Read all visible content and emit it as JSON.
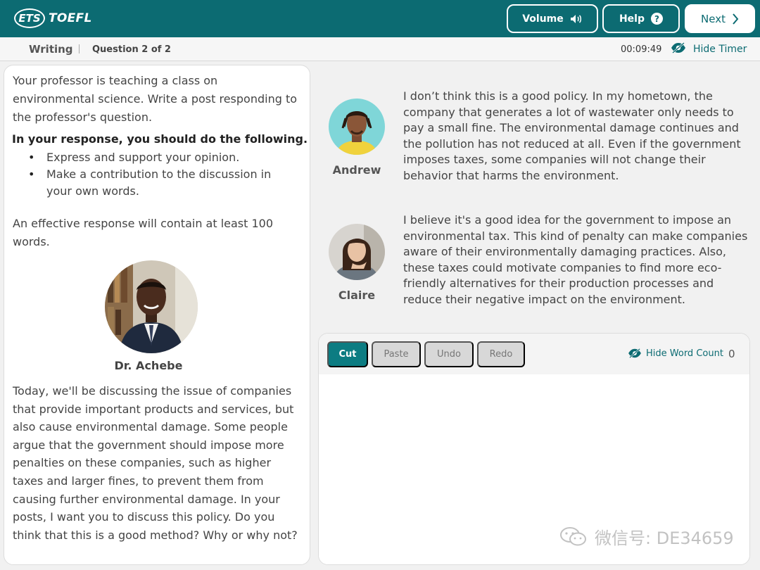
{
  "header": {
    "logo_ets": "ETS",
    "logo_toefl": "TOEFL",
    "volume_label": "Volume",
    "help_label": "Help",
    "help_symbol": "?",
    "next_label": "Next"
  },
  "subbar": {
    "section": "Writing",
    "question": "Question 2 of 2",
    "timer": "00:09:49",
    "hide_timer": "Hide Timer"
  },
  "prompt": {
    "intro": "Your professor is teaching a class on environmental science. Write a post responding to the professor's question.",
    "instructions_heading": "In your response, you should do the following.",
    "bullets": [
      "Express and support your opinion.",
      "Make a contribution to the discussion in your own words."
    ],
    "effective": "An effective response will contain at least 100 words.",
    "professor_name": "Dr. Achebe",
    "professor_text": "Today, we'll be discussing the issue of companies that provide important products and services, but also cause environmental damage. Some people argue that the government should impose more penalties on these companies, such as higher taxes and larger fines, to prevent them from causing further environmental damage. In your posts, I want you to discuss this policy. Do you think that this is a good method? Why or why not?"
  },
  "students": [
    {
      "name": "Andrew",
      "post": "I don’t think this is a good policy. In my hometown, the company that generates a lot of wastewater only needs to pay a small fine. The environmental damage continues and the pollution has not reduced at all. Even if the government imposes taxes, some companies will not change their behavior that harms the environment."
    },
    {
      "name": "Claire",
      "post": "I believe it's a good idea for the government to impose an environmental tax. This kind of penalty can make companies aware of their environmentally damaging practices. Also, these taxes could motivate companies to find more eco-friendly alternatives for their production processes and reduce their negative impact on the environment."
    }
  ],
  "editor": {
    "cut": "Cut",
    "paste": "Paste",
    "undo": "Undo",
    "redo": "Redo",
    "hide_word_count": "Hide Word Count",
    "word_count": "0",
    "response_value": ""
  },
  "watermark": "微信号: DE34659",
  "colors": {
    "brand_teal": "#0c6b72",
    "cut_button": "#0c7c82",
    "disabled_button": "#d8d8d8"
  },
  "icons": [
    "volume-icon",
    "help-icon",
    "chevron-right-icon",
    "eye-icon",
    "wechat-icon"
  ]
}
